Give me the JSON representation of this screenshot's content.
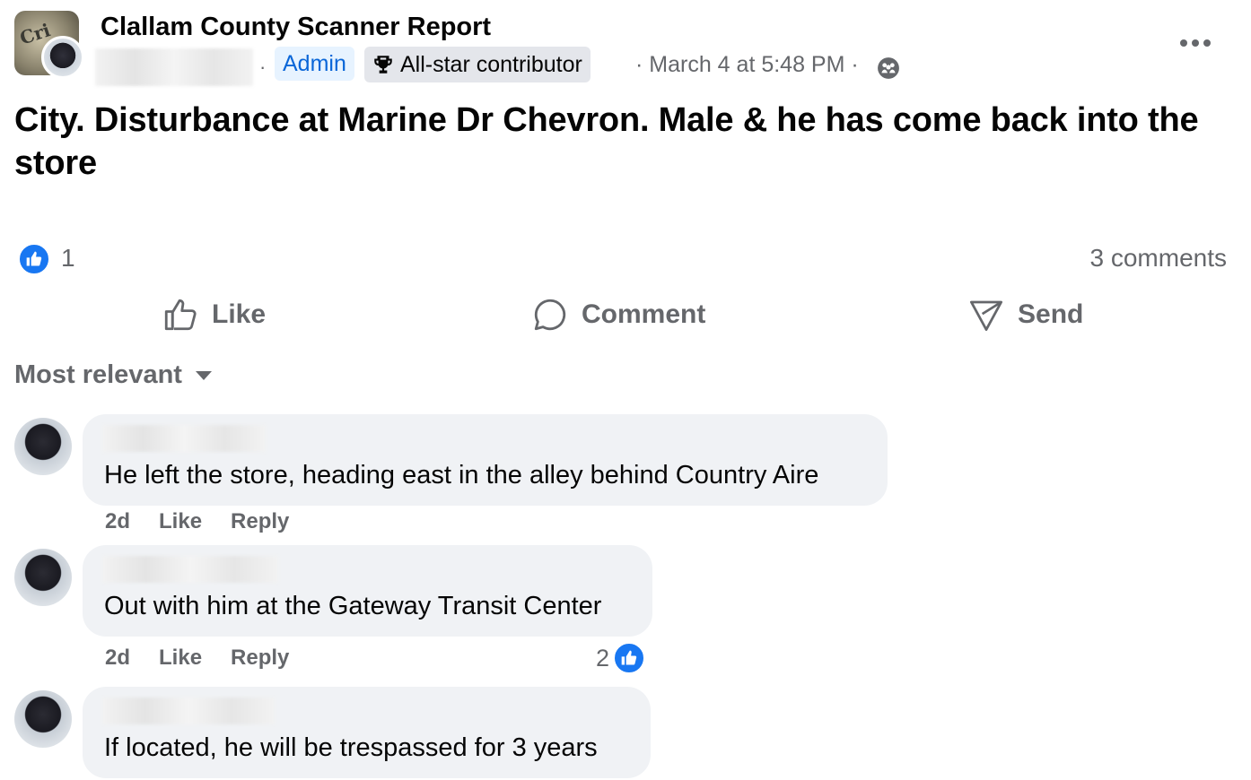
{
  "post": {
    "group_name": "Clallam County Scanner Report",
    "separator": "·",
    "admin_badge": "Admin",
    "allstar_badge": "All-star contributor",
    "timestamp": "March 4 at 5:48 PM",
    "text": "City. Disturbance at Marine Dr Chevron. Male & he has come back into the store",
    "reaction_count": "1",
    "comments_count": "3 comments",
    "privacy_icon": "group-members-icon",
    "more_icon": "more-options-icon"
  },
  "actions": {
    "like": "Like",
    "comment": "Comment",
    "send": "Send"
  },
  "sort": {
    "label": "Most relevant"
  },
  "comments": [
    {
      "text": "He left the store, heading east in the alley behind Country Aire",
      "age": "2d",
      "like": "Like",
      "reply": "Reply"
    },
    {
      "text": "Out with him at the Gateway Transit Center",
      "age": "2d",
      "like": "Like",
      "reply": "Reply",
      "reactions": "2"
    },
    {
      "text": "If located, he will be trespassed for 3 years"
    }
  ],
  "colors": {
    "accent": "#1877f2",
    "secondary_text": "#65676b",
    "bubble": "#f0f2f5",
    "admin_badge_bg": "#e7f3ff",
    "allstar_badge_bg": "#e4e6eb"
  }
}
